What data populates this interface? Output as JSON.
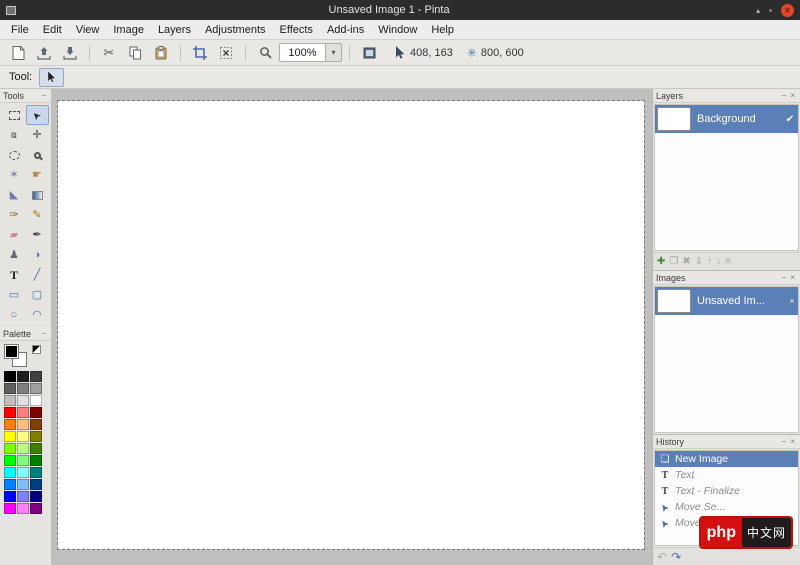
{
  "window": {
    "title": "Unsaved Image 1 - Pinta",
    "controls": {
      "shade": "▴",
      "maximize": "▪",
      "close": "✕"
    }
  },
  "menubar": {
    "items": [
      "File",
      "Edit",
      "View",
      "Image",
      "Layers",
      "Adjustments",
      "Effects",
      "Add-ins",
      "Window",
      "Help"
    ]
  },
  "toolbar": {
    "zoom_value": "100%",
    "zoom_dropdown_glyph": "▾",
    "cut_glyph": "✂",
    "position_value": "408, 163",
    "size_value": "800, 600",
    "size_icon_glyph": "✳"
  },
  "tool_options": {
    "label": "Tool:"
  },
  "panel_controls": {
    "minimize": "−",
    "close": "×"
  },
  "tools_panel": {
    "title": "Tools",
    "tools": [
      {
        "name": "rectangle-select",
        "cls": "shape-dashed-rect"
      },
      {
        "name": "move-selected",
        "glyph": "➤",
        "cls": "rot-nw",
        "active": true
      },
      {
        "name": "lasso-select",
        "glyph": "ҩ",
        "color": "#555555"
      },
      {
        "name": "move-selection",
        "glyph": "✛",
        "color": "#444444"
      },
      {
        "name": "ellipse-select",
        "cls": "shape-dashed-ellipse"
      },
      {
        "name": "zoom",
        "cls": "shape-magnifier"
      },
      {
        "name": "magic-wand",
        "glyph": "✶",
        "color": "#8a7ab8"
      },
      {
        "name": "pan",
        "glyph": "☛",
        "color": "#b08850"
      },
      {
        "name": "paint-bucket",
        "glyph": "◣",
        "color": "#6a7fae"
      },
      {
        "name": "gradient",
        "cls": "shape-gradient"
      },
      {
        "name": "paintbrush",
        "glyph": "✑",
        "color": "#8a5a30"
      },
      {
        "name": "pencil",
        "glyph": "✎",
        "color": "#a07818"
      },
      {
        "name": "eraser",
        "glyph": "▰",
        "color": "#d08898"
      },
      {
        "name": "color-picker",
        "glyph": "✒",
        "color": "#444455"
      },
      {
        "name": "clone-stamp",
        "glyph": "♟",
        "color": "#666677"
      },
      {
        "name": "recolor",
        "glyph": "◑",
        "color": "#7a6aa0"
      },
      {
        "name": "text",
        "glyph": "T",
        "cls": "serif"
      },
      {
        "name": "line-curve",
        "glyph": "╱",
        "color": "#4a6da7"
      },
      {
        "name": "rectangle",
        "glyph": "▭",
        "color": "#4a6da7"
      },
      {
        "name": "rounded-rectangle",
        "glyph": "▢",
        "color": "#4a6da7"
      },
      {
        "name": "ellipse",
        "glyph": "○",
        "color": "#4a6da7"
      },
      {
        "name": "freeform-shape",
        "glyph": "◠",
        "color": "#4a6da7"
      }
    ]
  },
  "palette_panel": {
    "title": "Palette",
    "primary_color": "#000000",
    "secondary_color": "#ffffff",
    "colors": [
      "#000000",
      "#1f1f1f",
      "#3f3f3f",
      "#5f5f5f",
      "#7f7f7f",
      "#9f9f9f",
      "#bfbfbf",
      "#dfdfdf",
      "#ffffff",
      "#ff0000",
      "#ff7f7f",
      "#7f0000",
      "#ff7f00",
      "#ffbf7f",
      "#7f3f00",
      "#ffff00",
      "#ffff7f",
      "#7f7f00",
      "#7fff00",
      "#bfff7f",
      "#3f7f00",
      "#00ff00",
      "#7fff7f",
      "#007f00",
      "#00ffff",
      "#7fffff",
      "#007f7f",
      "#007fff",
      "#7fbfff",
      "#003f7f",
      "#0000ff",
      "#7f7fff",
      "#00007f",
      "#ff00ff",
      "#ff7fff",
      "#7f007f"
    ]
  },
  "layers_panel": {
    "title": "Layers",
    "layer": {
      "name": "Background",
      "visible_glyph": "✔"
    },
    "buttons": [
      {
        "name": "add-layer",
        "glyph": "✚",
        "enabled": true
      },
      {
        "name": "duplicate-layer",
        "glyph": "❐"
      },
      {
        "name": "delete-layer",
        "glyph": "✖"
      },
      {
        "name": "merge-layer-down",
        "glyph": "⇓"
      },
      {
        "name": "move-layer-up",
        "glyph": "↑"
      },
      {
        "name": "move-layer-down",
        "glyph": "↓"
      },
      {
        "name": "layer-properties",
        "glyph": "≡"
      }
    ]
  },
  "images_panel": {
    "title": "Images",
    "image": {
      "name": "Unsaved Im...",
      "close_glyph": "×"
    }
  },
  "history_panel": {
    "title": "History",
    "icon_glyphs": {
      "image": "❏",
      "text": "T",
      "move": "➤"
    },
    "items": [
      {
        "label": "New Image",
        "icon": "image",
        "state": "selected"
      },
      {
        "label": "Text",
        "icon": "text",
        "state": "undone"
      },
      {
        "label": "Text - Finalize",
        "icon": "text",
        "state": "undone"
      },
      {
        "label": "Move Se...",
        "icon": "move",
        "state": "undone"
      },
      {
        "label": "Move Se...",
        "icon": "move",
        "state": "undone"
      }
    ],
    "undo_glyph": "↶",
    "redo_glyph": "↷"
  },
  "watermark": {
    "text_left": "php",
    "text_right": "中文网"
  },
  "colors": {
    "accent": "#5b80b8",
    "titlebar": "#2c2c2c",
    "close_button": "#e2472e",
    "canvas_surround": "#bfbfbf",
    "canvas": "#ffffff"
  }
}
